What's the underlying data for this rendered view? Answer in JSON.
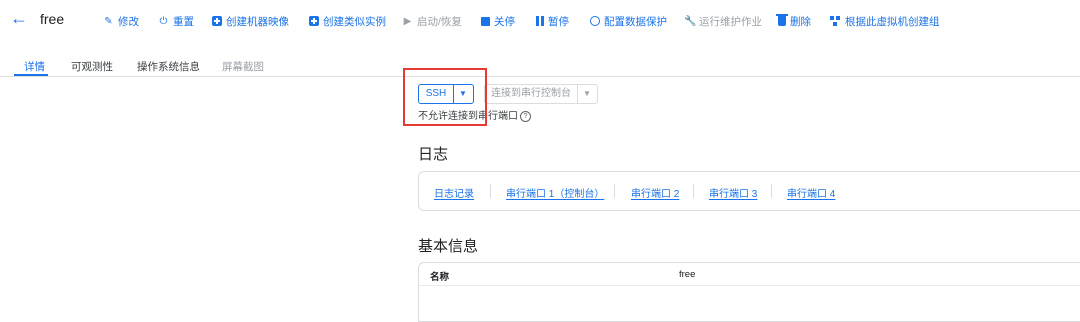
{
  "header": {
    "vm_name": "free",
    "toolbar": [
      {
        "key": "edit",
        "label": "修改",
        "icon": "pencil-icon",
        "disabled": false
      },
      {
        "key": "reset",
        "label": "重置",
        "icon": "power-icon",
        "disabled": false
      },
      {
        "key": "create_image",
        "label": "创建机器映像",
        "icon": "add-box-icon",
        "disabled": false
      },
      {
        "key": "create_similar",
        "label": "创建类似实例",
        "icon": "add-box-icon",
        "disabled": false
      },
      {
        "key": "start",
        "label": "启动/恢复",
        "icon": "play-icon",
        "disabled": true
      },
      {
        "key": "stop",
        "label": "关停",
        "icon": "stop-icon",
        "disabled": false
      },
      {
        "key": "pause",
        "label": "暂停",
        "icon": "pause-icon",
        "disabled": false
      },
      {
        "key": "data_protect",
        "label": "配置数据保护",
        "icon": "shield-icon",
        "disabled": false
      },
      {
        "key": "ops",
        "label": "运行维护作业",
        "icon": "wrench-icon",
        "disabled": true
      },
      {
        "key": "delete",
        "label": "删除",
        "icon": "trash-icon",
        "disabled": false
      },
      {
        "key": "create_group",
        "label": "根据此虚拟机创建组",
        "icon": "group-icon",
        "disabled": false
      }
    ]
  },
  "tabs": [
    {
      "label": "详情",
      "state": "active"
    },
    {
      "label": "可观测性",
      "state": "normal"
    },
    {
      "label": "操作系统信息",
      "state": "normal"
    },
    {
      "label": "屏幕截图",
      "state": "disabled"
    }
  ],
  "connect": {
    "ssh_label": "SSH",
    "serial_label": "连接到串行控制台",
    "serial_note": "不允许连接到串行端口"
  },
  "logs": {
    "title": "日志",
    "links": [
      "日志记录",
      "串行端口 1（控制台）",
      "串行端口 2",
      "串行端口 3",
      "串行端口 4"
    ]
  },
  "basic_info": {
    "title": "基本信息",
    "rows": [
      {
        "key": "名称",
        "value": "free"
      }
    ]
  },
  "colors": {
    "accent": "#1a73e8",
    "highlight": "#e53935"
  }
}
